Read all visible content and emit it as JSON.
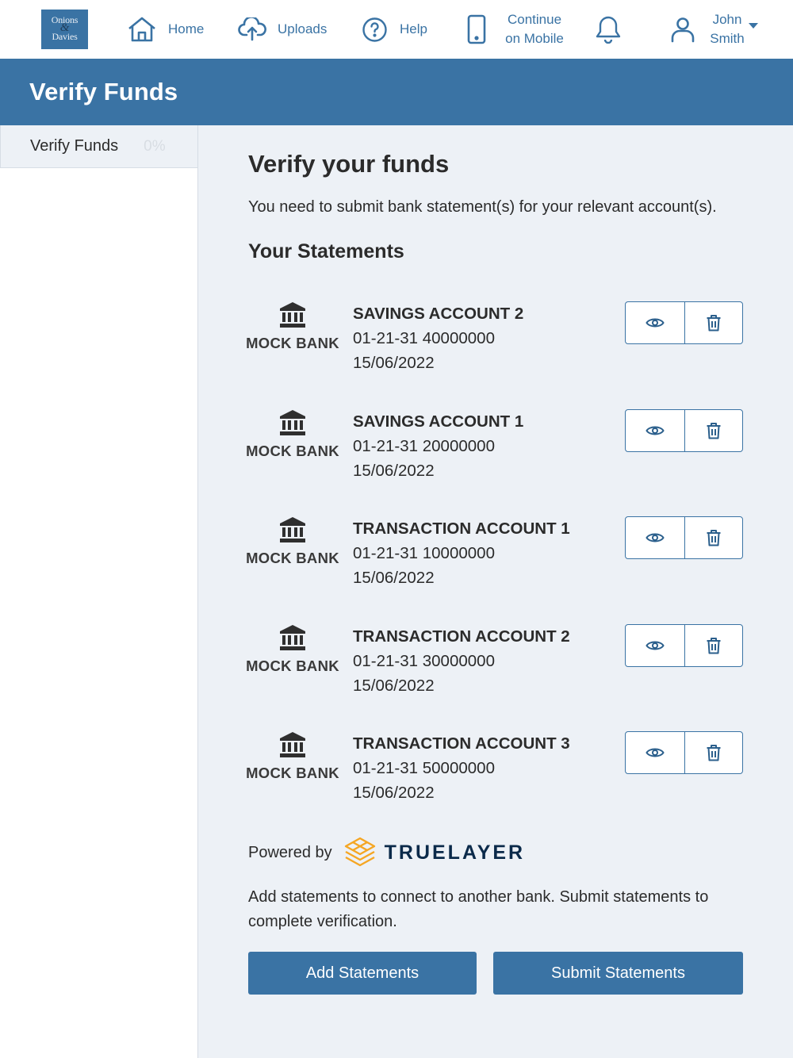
{
  "logo": {
    "line1": "Onions",
    "amp": "&",
    "line2": "Davies"
  },
  "nav": {
    "home": "Home",
    "uploads": "Uploads",
    "help": "Help",
    "mobile": "Continue on Mobile",
    "user": "John Smith"
  },
  "banner": {
    "title": "Verify Funds"
  },
  "sidebar": {
    "items": [
      {
        "label": "Verify Funds",
        "progress": "0%"
      }
    ]
  },
  "main": {
    "heading": "Verify your funds",
    "intro": "You need to submit bank statement(s) for your relevant account(s).",
    "statements_heading": "Your Statements",
    "statements": [
      {
        "bank": "MOCK BANK",
        "account": "SAVINGS ACCOUNT 2",
        "number": "01-21-31 40000000",
        "date": "15/06/2022"
      },
      {
        "bank": "MOCK BANK",
        "account": "SAVINGS ACCOUNT 1",
        "number": "01-21-31 20000000",
        "date": "15/06/2022"
      },
      {
        "bank": "MOCK BANK",
        "account": "TRANSACTION ACCOUNT 1",
        "number": "01-21-31 10000000",
        "date": "15/06/2022"
      },
      {
        "bank": "MOCK BANK",
        "account": "TRANSACTION ACCOUNT 2",
        "number": "01-21-31 30000000",
        "date": "15/06/2022"
      },
      {
        "bank": "MOCK BANK",
        "account": "TRANSACTION ACCOUNT 3",
        "number": "01-21-31 50000000",
        "date": "15/06/2022"
      }
    ],
    "powered_by": "Powered by",
    "provider": "TRUELAYER",
    "note": "Add statements to connect to another bank. Submit statements to complete verification.",
    "add_button": "Add Statements",
    "submit_button": "Submit Statements"
  },
  "icons": {
    "home": "home-icon",
    "uploads": "cloud-upload-icon",
    "help": "help-circle-icon",
    "mobile": "mobile-phone-icon",
    "bell": "bell-icon",
    "user": "user-icon",
    "bank": "bank-building-icon",
    "view": "eye-icon",
    "delete": "trash-icon",
    "provider_logo": "truelayer-logo-icon"
  },
  "colors": {
    "brand": "#3a73a4",
    "background": "#edf1f6",
    "provider_accent": "#f5a623"
  }
}
